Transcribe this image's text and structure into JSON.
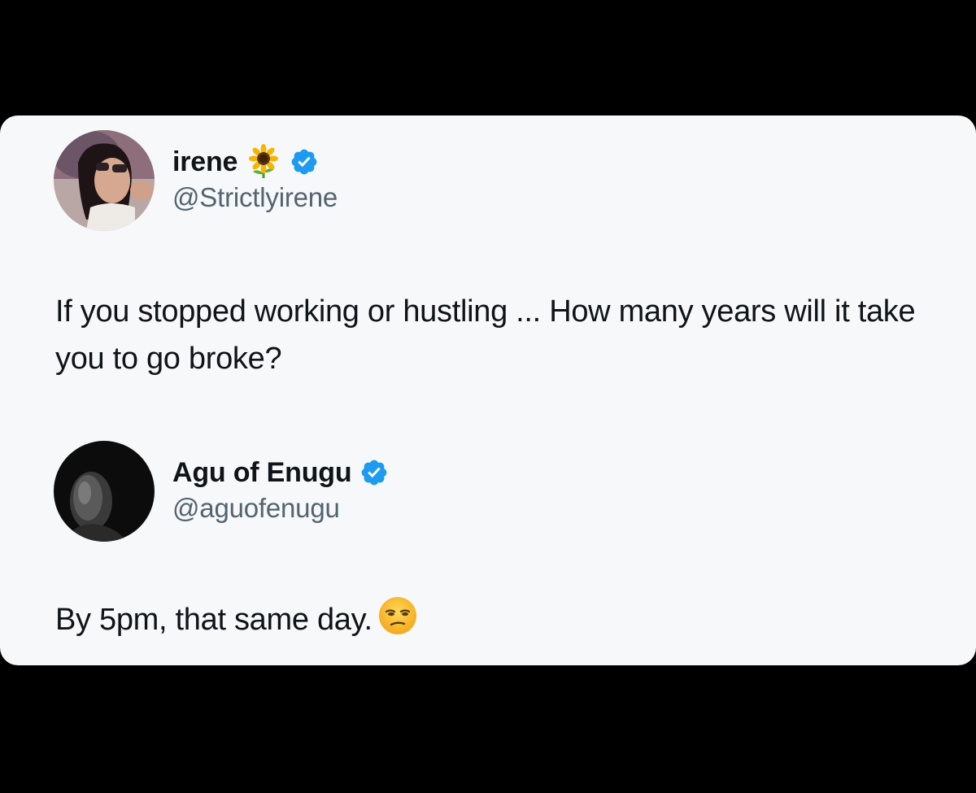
{
  "tweets": [
    {
      "display_name": "irene",
      "name_emoji": "sunflower",
      "verified": true,
      "handle": "@Strictlyirene",
      "text": "If you stopped working or hustling ... How many years will it take you to go broke?"
    },
    {
      "display_name": "Agu of Enugu",
      "verified": true,
      "handle": "@aguofenugu",
      "text": "By 5pm, that same day.",
      "trailing_emoji": "unamused-face"
    }
  ],
  "colors": {
    "background": "#000000",
    "card": "#f7f8f9",
    "text_primary": "#0f1419",
    "text_secondary": "#536471",
    "verified_blue": "#1d9bf0"
  }
}
